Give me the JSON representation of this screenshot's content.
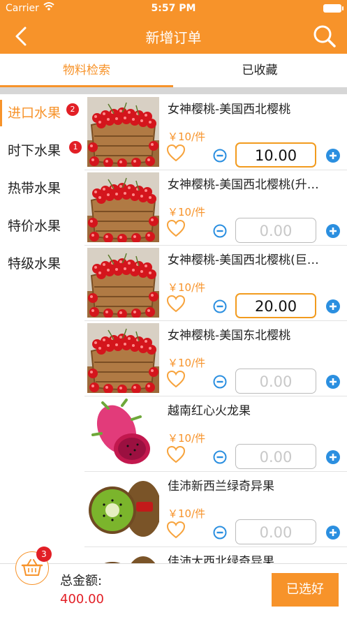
{
  "status_bar": {
    "carrier": "Carrier",
    "time": "5:57 PM"
  },
  "header": {
    "title": "新增订单"
  },
  "tabs": [
    {
      "label": "物料检索"
    },
    {
      "label": "已收藏"
    }
  ],
  "categories": [
    {
      "label": "进口水果",
      "badge": "2"
    },
    {
      "label": "时下水果",
      "badge": "1"
    },
    {
      "label": "热带水果"
    },
    {
      "label": "特价水果"
    },
    {
      "label": "特级水果"
    }
  ],
  "products": [
    {
      "name": "女神樱桃-美国西北樱桃",
      "price": "￥10/件",
      "qty": "10.00",
      "thumb": "cherry"
    },
    {
      "name": "女神樱桃-美国西北樱桃(升…",
      "price": "￥10/件",
      "qty": "0.00",
      "thumb": "cherry"
    },
    {
      "name": "女神樱桃-美国西北樱桃(巨…",
      "price": "￥10/件",
      "qty": "20.00",
      "thumb": "cherry"
    },
    {
      "name": "女神樱桃-美国东北樱桃",
      "price": "￥10/件",
      "qty": "0.00",
      "thumb": "cherry"
    },
    {
      "name": "越南红心火龙果",
      "price": "￥10/件",
      "qty": "0.00",
      "thumb": "dragonfruit"
    },
    {
      "name": "佳沛新西兰绿奇异果",
      "price": "￥10/件",
      "qty": "0.00",
      "thumb": "kiwi"
    },
    {
      "name": "佳沛大西北绿奇异果",
      "price": "",
      "qty": "",
      "thumb": "kiwi"
    }
  ],
  "bottom": {
    "cart_badge": "3",
    "total_label": "总金额:",
    "total_value": "400.00",
    "confirm_label": "已选好"
  },
  "colors": {
    "accent": "#f7932a",
    "badge": "#e21f26",
    "stepper": "#2b8fe0"
  }
}
